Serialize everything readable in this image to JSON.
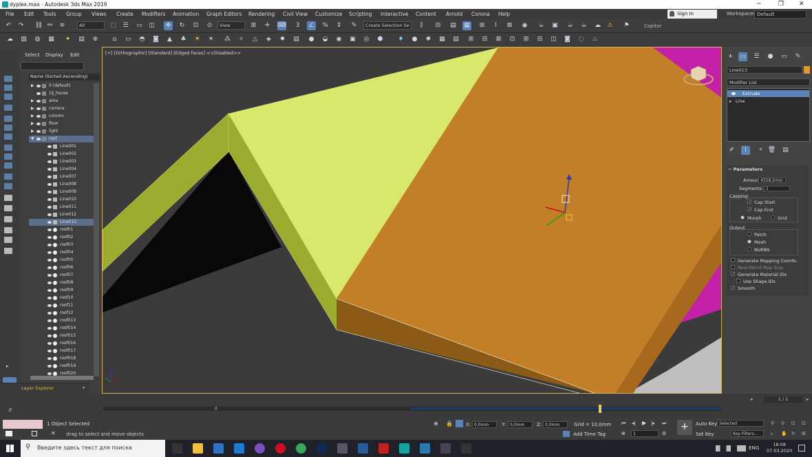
{
  "window": {
    "title": "dyplex.max - Autodesk 3ds Max 2019",
    "controls": [
      "─",
      "❐",
      "✕"
    ]
  },
  "menu": [
    "File",
    "Edit",
    "Tools",
    "Group",
    "Views",
    "Create",
    "Modifiers",
    "Animation",
    "Graph Editors",
    "Rendering",
    "Civil View",
    "Customize",
    "Scripting",
    "Interactive",
    "Content",
    "Arnold",
    "Corona",
    "Help"
  ],
  "sign_in": "Sign In",
  "workspaces": {
    "label": "Workspaces:",
    "value": "Default"
  },
  "toolbar": {
    "selection_filter": "All",
    "ref_coord": "View",
    "named_selection_placeholder": "Create Selection Se",
    "copitor": "Copitor"
  },
  "explorer": {
    "tabs": [
      "Select",
      "Display",
      "Edit"
    ],
    "column_header": "Name (Sorted Ascending)",
    "rows": [
      {
        "label": "0 (default)",
        "level": 0,
        "kind": "layer",
        "arrow": "▶"
      },
      {
        "label": "1§_house",
        "level": 0,
        "kind": "layer",
        "arrow": ""
      },
      {
        "label": "area",
        "level": 0,
        "kind": "layer",
        "arrow": "▶"
      },
      {
        "label": "camera",
        "level": 0,
        "kind": "layer",
        "arrow": "▶"
      },
      {
        "label": "column",
        "level": 0,
        "kind": "layer",
        "arrow": "▶"
      },
      {
        "label": "floor",
        "level": 0,
        "kind": "layer",
        "arrow": "▶"
      },
      {
        "label": "light",
        "level": 0,
        "kind": "layer",
        "arrow": "▶"
      },
      {
        "label": "roof",
        "level": 0,
        "kind": "layer",
        "arrow": "▼",
        "selected": true
      },
      {
        "label": "Line001",
        "level": 1,
        "kind": "shape"
      },
      {
        "label": "Line002",
        "level": 1,
        "kind": "shape"
      },
      {
        "label": "Line003",
        "level": 1,
        "kind": "shape"
      },
      {
        "label": "Line004",
        "level": 1,
        "kind": "shape"
      },
      {
        "label": "Line007",
        "level": 1,
        "kind": "shape"
      },
      {
        "label": "Line008",
        "level": 1,
        "kind": "shape"
      },
      {
        "label": "Line009",
        "level": 1,
        "kind": "shape"
      },
      {
        "label": "Line010",
        "level": 1,
        "kind": "shape"
      },
      {
        "label": "Line011",
        "level": 1,
        "kind": "shape"
      },
      {
        "label": "Line012",
        "level": 1,
        "kind": "shape"
      },
      {
        "label": "Line013",
        "level": 1,
        "kind": "shape",
        "selected": true
      },
      {
        "label": "roof01",
        "level": 1,
        "kind": "mesh"
      },
      {
        "label": "roof02",
        "level": 1,
        "kind": "mesh"
      },
      {
        "label": "roof03",
        "level": 1,
        "kind": "mesh"
      },
      {
        "label": "roof04",
        "level": 1,
        "kind": "mesh"
      },
      {
        "label": "roof05",
        "level": 1,
        "kind": "mesh"
      },
      {
        "label": "roof06",
        "level": 1,
        "kind": "mesh"
      },
      {
        "label": "roof07",
        "level": 1,
        "kind": "mesh"
      },
      {
        "label": "roof08",
        "level": 1,
        "kind": "mesh"
      },
      {
        "label": "roof09",
        "level": 1,
        "kind": "mesh"
      },
      {
        "label": "roof10",
        "level": 1,
        "kind": "mesh"
      },
      {
        "label": "roof11",
        "level": 1,
        "kind": "mesh"
      },
      {
        "label": "roof12",
        "level": 1,
        "kind": "mesh"
      },
      {
        "label": "roof013",
        "level": 1,
        "kind": "mesh"
      },
      {
        "label": "roof014",
        "level": 1,
        "kind": "mesh"
      },
      {
        "label": "roof015",
        "level": 1,
        "kind": "mesh"
      },
      {
        "label": "roof016",
        "level": 1,
        "kind": "mesh"
      },
      {
        "label": "roof017",
        "level": 1,
        "kind": "mesh"
      },
      {
        "label": "roof018",
        "level": 1,
        "kind": "mesh"
      },
      {
        "label": "roof019",
        "level": 1,
        "kind": "mesh"
      },
      {
        "label": "roof020",
        "level": 1,
        "kind": "mesh"
      }
    ],
    "footer": "Layer Explorer"
  },
  "viewport": {
    "label": "[+] [Orthographic] [Standard] [Edged Faces]  <<Disabled>>",
    "colors": {
      "orange": "#c27f28",
      "lime": "#d8e86a",
      "olive": "#9aab2e",
      "magenta": "#c41fa8",
      "dark": "#3b3b3b",
      "border": "#d6b25e"
    }
  },
  "command_panel": {
    "object_name": "Line013",
    "object_color": "#d99a37",
    "modifier_list": "Modifier List",
    "stack": [
      "Extrude",
      "Line"
    ],
    "rollout_title": "Parameters",
    "amount_label": "Amount:",
    "amount_value": "4558,5mm",
    "segments_label": "Segments:",
    "segments_value": "1",
    "capping_label": "Capping",
    "cap_start": "Cap Start",
    "cap_end": "Cap End",
    "morph": "Morph",
    "grid": "Grid",
    "output_label": "Output",
    "patch": "Patch",
    "mesh": "Mesh",
    "nurbs": "NURBS",
    "gen_mapping": "Generate Mapping Coords.",
    "real_world": "Real-World Map Size",
    "gen_material": "Generate Material IDs",
    "use_shape_ids": "Use Shape IDs",
    "smooth": "Smooth"
  },
  "timeline": {
    "frame": "1 / 1",
    "start": "0"
  },
  "status": {
    "selected": "1 Object Selected",
    "prompt": "drag to select and move objects",
    "x_label": "X:",
    "x_value": "0,0mm",
    "y_label": "Y:",
    "y_value": "0,0mm",
    "z_label": "Z:",
    "z_value": "0,0mm",
    "grid": "Grid = 10,0mm",
    "add_time_tag": "Add Time Tag",
    "auto_key": "Auto Key",
    "set_key": "Set Key",
    "selected_dd": "Selected",
    "key_filters": "Key Filters...",
    "frame_field": "1"
  },
  "taskbar": {
    "search_placeholder": "Введите здесь текст для поиска",
    "lang": "ENG",
    "time": "18:08",
    "date": "07.03.2020"
  }
}
